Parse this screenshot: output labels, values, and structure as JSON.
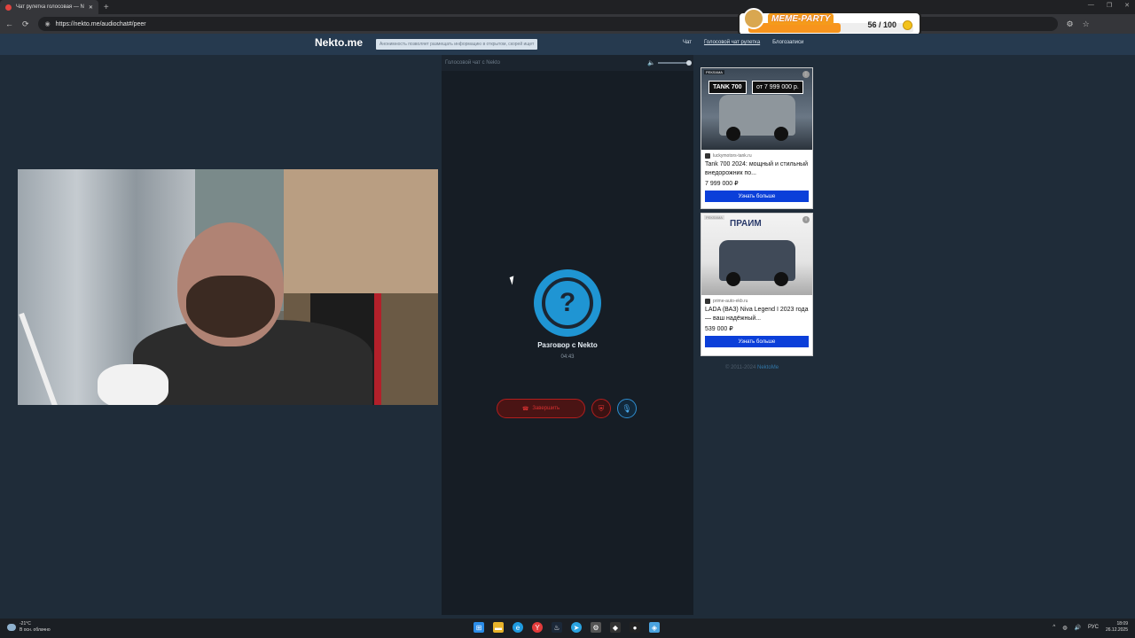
{
  "browser": {
    "tab_title": "Чат рулетка голосовая — N",
    "new_tab": "+",
    "url": "https://nekto.me/audiochat#/peer",
    "back": "←",
    "reload": "⟳",
    "window_controls": [
      "—",
      "❐",
      "✕"
    ],
    "toolbar_icons": [
      "extension-icon",
      "star-icon",
      "profile-icon"
    ]
  },
  "overlay": {
    "title": "MEME-PARTY",
    "progress_text": "56 / 100",
    "progress_fraction": 0.56
  },
  "site": {
    "brand": "Nekto.me",
    "notice": "Анонимность позволяет размещать информацию в открытом, скорей ищет",
    "nav": [
      {
        "label": "Чат",
        "active": false
      },
      {
        "label": "Голосовой чат рулетка",
        "active": true
      },
      {
        "label": "Блогозаписи",
        "active": false
      }
    ]
  },
  "voice_chat": {
    "header": "Голосовой чат с Nekto",
    "status_icon": "?",
    "title": "Разговор с Nekto",
    "timer": "04:43",
    "end_button": "Завершить",
    "volume_level": 1.0
  },
  "ads": [
    {
      "tag": "РЕКЛАМА",
      "badge1": "TANK 700",
      "badge2": "от 7 999 000 р.",
      "domain": "luckymotors-tank.ru",
      "title": "Tank 700 2024: мощный и стильный внедорожник по...",
      "price": "7 999 000 ₽",
      "button": "Узнать больше"
    },
    {
      "tag": "РЕКЛАМА",
      "logo": "ПРАИМ",
      "domain": "prime-auto-ekb.ru",
      "title": "LADA (ВАЗ) Niva Legend I 2023 года — ваш надёжный...",
      "price": "539 000 ₽",
      "button": "Узнать больше"
    }
  ],
  "footer": {
    "copyright": "© 2011-2024",
    "link": "NektoMe"
  },
  "taskbar": {
    "weather_temp": "-21°C",
    "weather_desc": "В осн. облачно",
    "lang": "РУС",
    "time": "18:09",
    "date": "26.12.2025"
  }
}
